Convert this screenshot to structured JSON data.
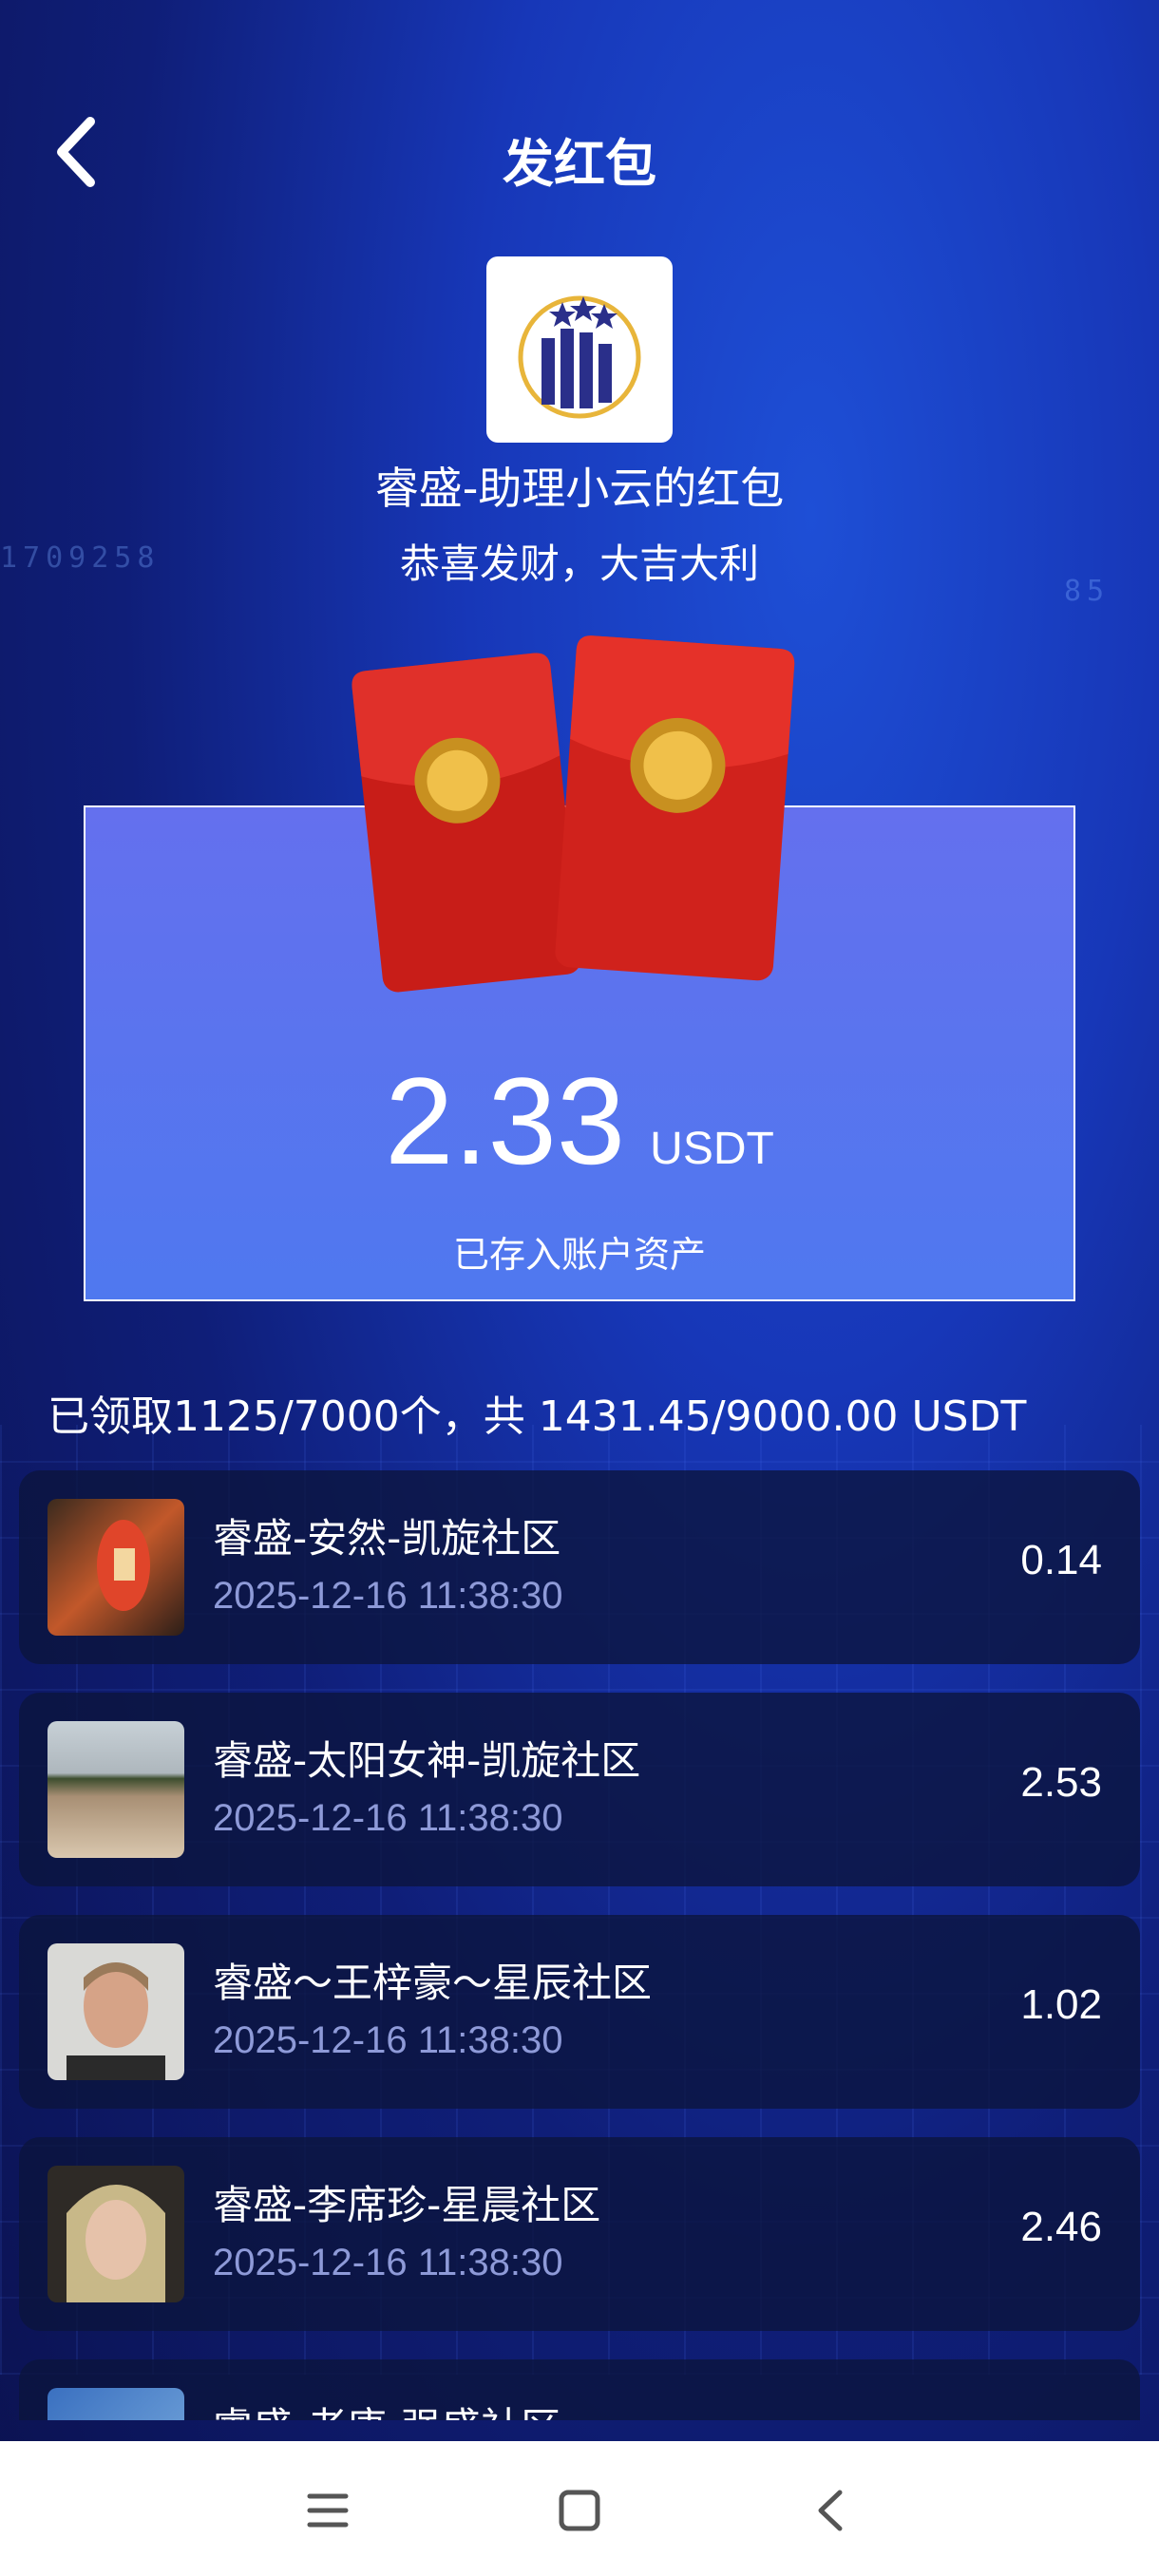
{
  "header": {
    "title": "发红包"
  },
  "packet": {
    "sender": "睿盛-助理小云的红包",
    "greeting": "恭喜发财，大吉大利",
    "amount": "2.33",
    "unit": "USDT",
    "stored_note": "已存入账户资产"
  },
  "summary": "已领取1125/7000个，共 1431.45/9000.00 USDT",
  "records": [
    {
      "name": "睿盛-安然-凯旋社区",
      "time": "2025-12-16 11:38:30",
      "amount": "0.14"
    },
    {
      "name": "睿盛-太阳女神-凯旋社区",
      "time": "2025-12-16 11:38:30",
      "amount": "2.53"
    },
    {
      "name": "睿盛～王梓豪～星辰社区",
      "time": "2025-12-16 11:38:30",
      "amount": "1.02"
    },
    {
      "name": "睿盛-李席珍-星晨社区",
      "time": "2025-12-16 11:38:30",
      "amount": "2.46"
    },
    {
      "name": "睿盛-老唐-强盛社区",
      "time": "",
      "amount": ""
    }
  ],
  "colors": {
    "accent": "#4f78ef",
    "envelope_red": "#d8261f",
    "coin_gold": "#e8b53a"
  },
  "icons": {
    "back": "chevron-left-icon",
    "menu": "menu-icon",
    "home": "square-icon",
    "nav_back": "chevron-left-icon"
  }
}
